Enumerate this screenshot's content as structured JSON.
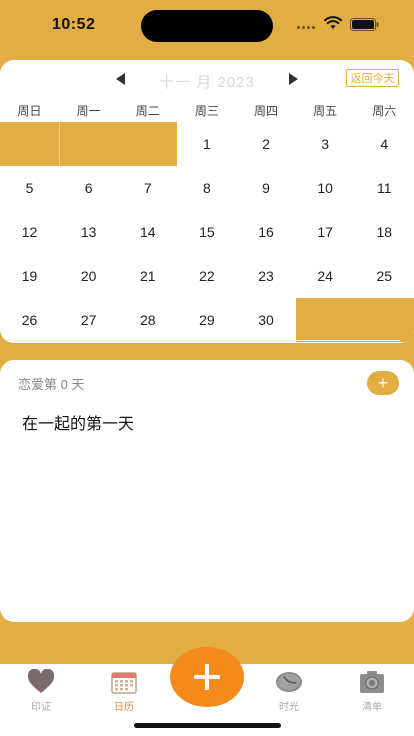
{
  "status_bar": {
    "time": "10:52"
  },
  "calendar": {
    "month_title": "十一 月 2023",
    "today_button": "返回今天",
    "weekdays": [
      "周日",
      "周一",
      "周二",
      "周三",
      "周四",
      "周五",
      "周六"
    ],
    "weeks": [
      [
        "",
        "",
        "",
        "1",
        "2",
        "3",
        "4"
      ],
      [
        "5",
        "6",
        "7",
        "8",
        "9",
        "10",
        "11"
      ],
      [
        "12",
        "13",
        "14",
        "15",
        "16",
        "17",
        "18"
      ],
      [
        "19",
        "20",
        "21",
        "22",
        "23",
        "24",
        "25"
      ],
      [
        "26",
        "27",
        "28",
        "29",
        "30",
        "",
        ""
      ]
    ]
  },
  "note": {
    "love_days": "恋爱第 0 天",
    "add_label": "+",
    "text": "在一起的第一天"
  },
  "tabs": [
    {
      "label": "印证",
      "icon": "heart-icon",
      "active": false
    },
    {
      "label": "日历",
      "icon": "calendar-icon",
      "active": true
    },
    {
      "label": "时光",
      "icon": "clock-icon",
      "active": false
    },
    {
      "label": "清单",
      "icon": "camera-icon",
      "active": false
    }
  ],
  "colors": {
    "accent": "#E2AD42",
    "fab": "#F28A1C",
    "active_tab": "#E8853A"
  }
}
